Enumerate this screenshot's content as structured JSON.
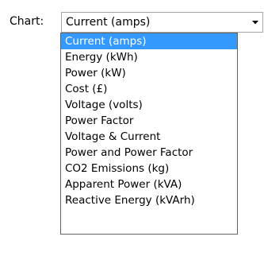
{
  "chart_control": {
    "label": "Chart:",
    "selected_value": "Current (amps)"
  },
  "dropdown": {
    "selected_index": 0,
    "highlight_color": "#3399ff",
    "options": [
      "Current (amps)",
      "Energy (kWh)",
      "Power (kW)",
      "Cost (£)",
      "Voltage (volts)",
      "Power Factor",
      "Voltage & Current",
      "Power and Power Factor",
      "CO2 Emissions (kg)",
      "Apparent Power (kVA)",
      "Reactive Energy (kVArh)"
    ]
  },
  "icons": {
    "dropdown_arrow": "chevron-down-icon"
  }
}
